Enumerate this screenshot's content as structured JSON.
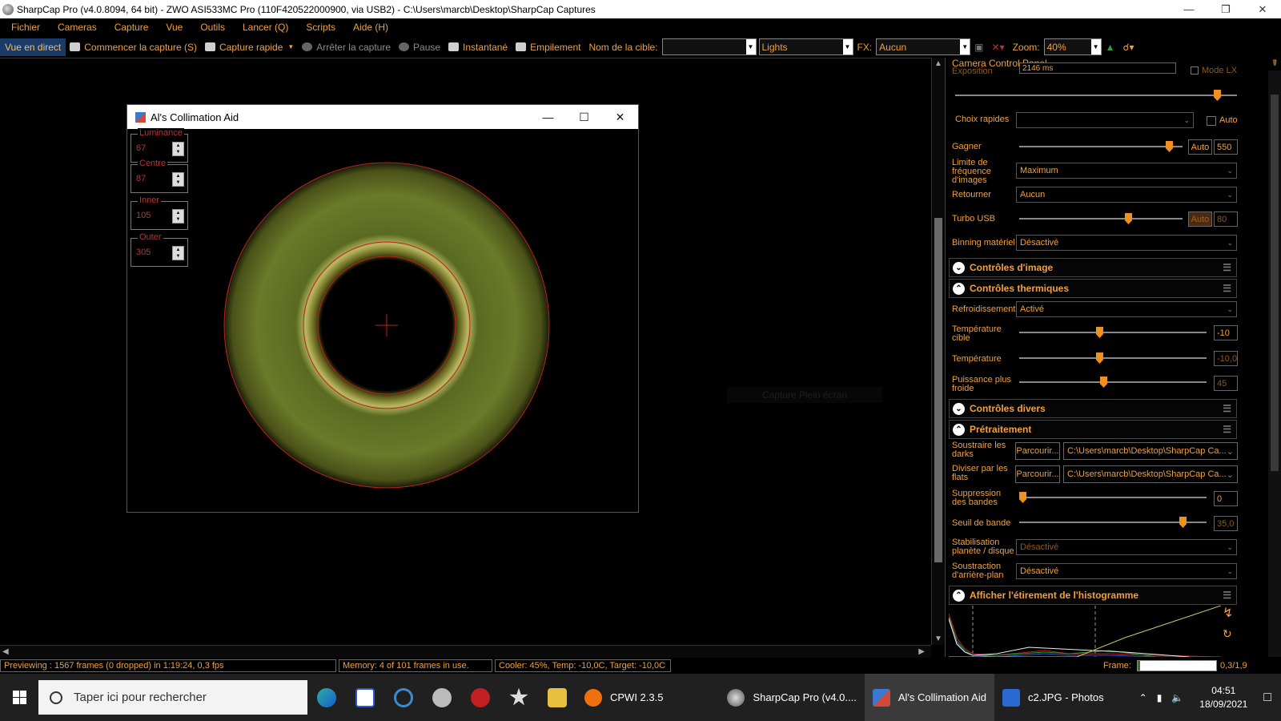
{
  "window": {
    "title": "SharpCap Pro (v4.0.8094, 64 bit) - ZWO ASI533MC Pro (110F420522000900, via USB2) - C:\\Users\\marcb\\Desktop\\SharpCap Captures"
  },
  "menu": [
    "Fichier",
    "Cameras",
    "Capture",
    "Vue",
    "Outils",
    "Lancer (Q)",
    "Scripts",
    "Aide (H)"
  ],
  "toolbar": {
    "live": "Vue en direct",
    "start_capture": "Commencer la capture (S)",
    "quick_capture": "Capture rapide",
    "stop_capture": "Arrêter la capture",
    "pause": "Pause",
    "snapshot": "Instantané",
    "stack": "Empilement",
    "target_label": "Nom de la cible:",
    "target_value": "",
    "frame_type": "Lights",
    "fx_label": "FX:",
    "fx_value": "Aucun",
    "zoom_label": "Zoom:",
    "zoom_value": "40%"
  },
  "collimation": {
    "title": "Al's Collimation Aid",
    "fields": [
      {
        "label": "Luminance",
        "value": "67"
      },
      {
        "label": "Centre",
        "value": "87"
      },
      {
        "label": "Inner",
        "value": "105"
      },
      {
        "label": "Outer",
        "value": "305"
      }
    ]
  },
  "fullscreen_capture": "Capture Plein écran",
  "panel": {
    "title": "Camera Control Panel",
    "exposure_label": "Exposition",
    "exposure_value": "2146 ms",
    "lx_mode": "Mode LX",
    "quick_choice_label": "Choix rapides",
    "quick_choice_auto": "Auto",
    "gain_label": "Gagner",
    "gain_auto": "Auto",
    "gain_value": "550",
    "gain_level": 0.9,
    "framerate_label": "Limite de fréquence d'images",
    "framerate_value": "Maximum",
    "flip_label": "Retourner",
    "flip_value": "Aucun",
    "turbo_label": "Turbo USB",
    "turbo_auto": "Auto",
    "turbo_value": "80",
    "turbo_level": 0.67,
    "binning_label": "Binning matériel",
    "binning_value": "Désactivé",
    "sec_image": "Contrôles d'image",
    "sec_thermal": "Contrôles thermiques",
    "cooling_label": "Refroidissement",
    "cooling_value": "Activé",
    "target_temp_label": "Température cible",
    "target_temp_value": "-10",
    "temp_label": "Température",
    "temp_value": "-10,0",
    "power_label": "Puissance plus froide",
    "power_value": "45",
    "sec_misc": "Contrôles divers",
    "sec_preproc": "Prétraitement",
    "darks_label": "Soustraire les darks",
    "darks_browse": "Parcourir...",
    "darks_path": "C:\\Users\\marcb\\Desktop\\SharpCap Ca...",
    "flats_label": "Diviser par les flats",
    "flats_browse": "Parcourir...",
    "flats_path": "C:\\Users\\marcb\\Desktop\\SharpCap Ca...",
    "banding_label": "Suppression des bandes",
    "banding_value": "0",
    "band_threshold_label": "Seuil de bande",
    "band_threshold_value": "35,0",
    "stab_label": "Stabilisation planète / disque",
    "stab_value": "Désactivé",
    "bgsub_label": "Soustraction d'arrière-plan",
    "bgsub_value": "Désactivé",
    "sec_histogram": "Afficher l'étirement de l'histogramme"
  },
  "status": {
    "preview": "Previewing : 1567 frames (0 dropped) in 1:19:24, 0,3 fps",
    "memory": "Memory: 4 of 101 frames in use.",
    "cooler": "Cooler: 45%, Temp: -10,0C, Target: -10,0C",
    "frame_label": "Frame:",
    "frame_value": "0,3/1,9"
  },
  "taskbar": {
    "search": "Taper ici pour rechercher",
    "tasks": [
      "CPWI 2.3.5",
      "SharpCap Pro (v4.0....",
      "Al's Collimation Aid",
      "c2.JPG - Photos"
    ],
    "time": "04:51",
    "date": "18/09/2021"
  }
}
